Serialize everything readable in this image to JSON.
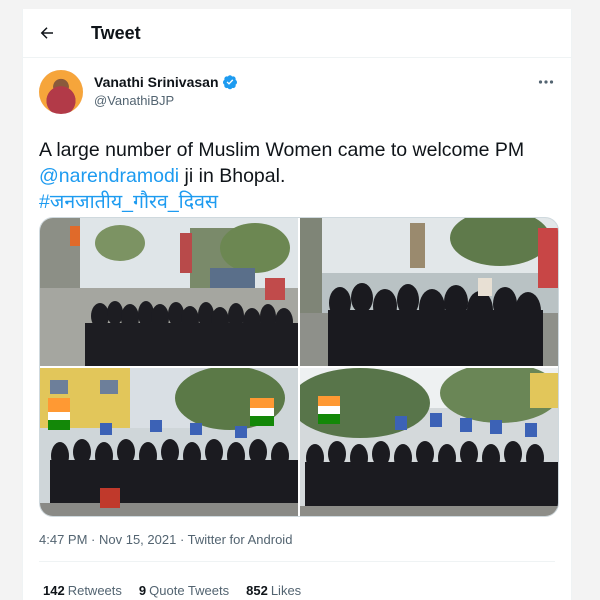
{
  "header": {
    "title": "Tweet",
    "back_icon": "arrow-left-icon"
  },
  "author": {
    "name": "Vanathi Srinivasan",
    "handle": "@VanathiBJP",
    "verified_icon": "verified-badge-icon",
    "more_icon": "more-dots-icon"
  },
  "tweet": {
    "text_before": "A large number of Muslim Women came to welcome PM ",
    "mention": "@narendramodi",
    "text_after": " ji in Bhopal.",
    "hashtag": "#जनजातीय_गौरव_दिवस"
  },
  "media": {
    "photo_count": 4
  },
  "meta": {
    "time": "4:47 PM",
    "sep1": " · ",
    "date": "Nov 15, 2021",
    "sep2": " · ",
    "source": "Twitter for Android"
  },
  "stats": {
    "retweets_count": "142",
    "retweets_label": "Retweets",
    "quotes_count": "9",
    "quotes_label": "Quote Tweets",
    "likes_count": "852",
    "likes_label": "Likes"
  },
  "colors": {
    "link": "#1d9bf0",
    "secondary_text": "#536471",
    "primary_text": "#0f1419"
  }
}
